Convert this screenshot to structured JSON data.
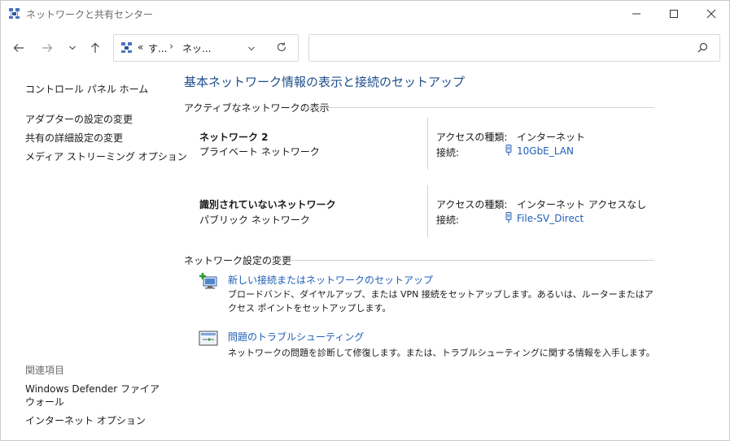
{
  "window": {
    "title": "ネットワークと共有センター"
  },
  "address_bar": {
    "crumb_more": "«",
    "crumb1": "す...",
    "sep": "›",
    "crumb2": "ネッ..."
  },
  "search": {
    "placeholder": ""
  },
  "left_pane": {
    "home_link": "コントロール パネル ホーム",
    "links": [
      "アダプターの設定の変更",
      "共有の詳細設定の変更",
      "メディア ストリーミング オプション"
    ],
    "related_heading": "関連項目",
    "related_links": [
      "Windows Defender ファイアウォール",
      "インターネット オプション"
    ]
  },
  "main": {
    "title": "基本ネットワーク情報の表示と接続のセットアップ",
    "active_heading": "アクティブなネットワークの表示",
    "networks": [
      {
        "name": "ネットワーク 2",
        "type": "プライベート ネットワーク",
        "access_label": "アクセスの種類:",
        "access_value": "インターネット",
        "conn_label": "接続:",
        "conn_value": "10GbE_LAN"
      },
      {
        "name": "識別されていないネットワーク",
        "type": "パブリック ネットワーク",
        "access_label": "アクセスの種類:",
        "access_value": "インターネット アクセスなし",
        "conn_label": "接続:",
        "conn_value": "File-SV_Direct"
      }
    ],
    "change_heading": "ネットワーク設定の変更",
    "tasks": [
      {
        "title": "新しい接続またはネットワークのセットアップ",
        "desc": "ブロードバンド、ダイヤルアップ、または VPN 接続をセットアップします。あるいは、ルーターまたはアクセス ポイントをセットアップします。"
      },
      {
        "title": "問題のトラブルシューティング",
        "desc": "ネットワークの問題を診断して修復します。または、トラブルシューティングに関する情報を入手します。"
      }
    ]
  },
  "colors": {
    "link": "#1f5fb4",
    "title": "#1f4e8c",
    "divider": "#d4d4d4"
  }
}
